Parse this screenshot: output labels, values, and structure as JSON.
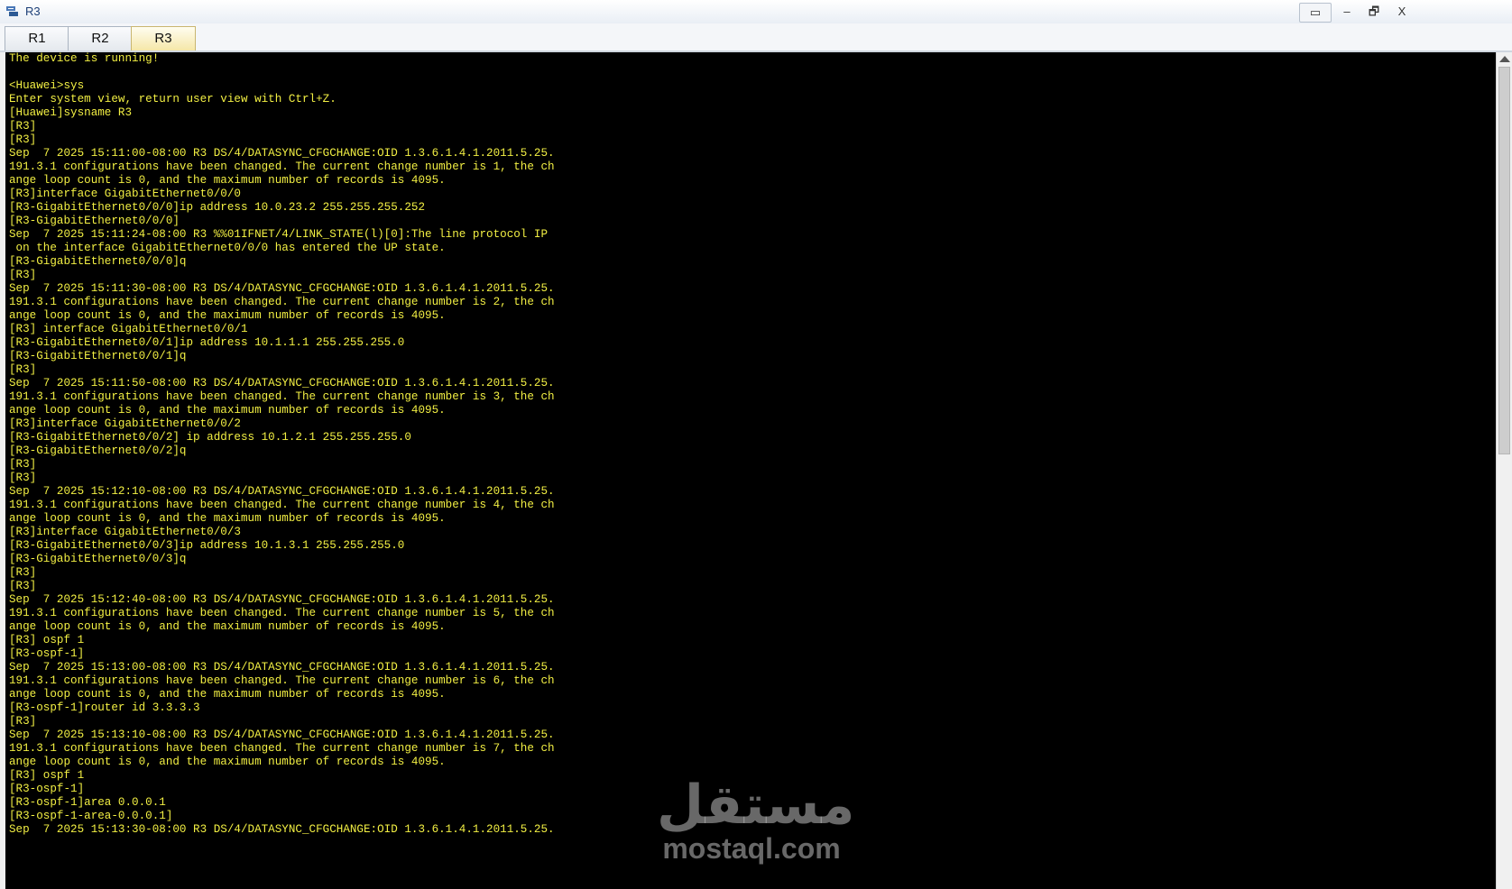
{
  "window": {
    "title": "R3",
    "restore_label": "▭",
    "minimize_label": "–",
    "maximize_label": "🗗",
    "close_label": "X"
  },
  "tabs": [
    {
      "label": "R1",
      "active": false
    },
    {
      "label": "R2",
      "active": false
    },
    {
      "label": "R3",
      "active": true
    }
  ],
  "terminal": {
    "lines": [
      "The device is running!",
      "",
      "<Huawei>sys",
      "Enter system view, return user view with Ctrl+Z.",
      "[Huawei]sysname R3",
      "[R3]",
      "[R3]",
      "Sep  7 2025 15:11:00-08:00 R3 DS/4/DATASYNC_CFGCHANGE:OID 1.3.6.1.4.1.2011.5.25.",
      "191.3.1 configurations have been changed. The current change number is 1, the ch",
      "ange loop count is 0, and the maximum number of records is 4095.",
      "[R3]interface GigabitEthernet0/0/0",
      "[R3-GigabitEthernet0/0/0]ip address 10.0.23.2 255.255.255.252",
      "[R3-GigabitEthernet0/0/0]",
      "Sep  7 2025 15:11:24-08:00 R3 %%01IFNET/4/LINK_STATE(l)[0]:The line protocol IP",
      " on the interface GigabitEthernet0/0/0 has entered the UP state.",
      "[R3-GigabitEthernet0/0/0]q",
      "[R3]",
      "Sep  7 2025 15:11:30-08:00 R3 DS/4/DATASYNC_CFGCHANGE:OID 1.3.6.1.4.1.2011.5.25.",
      "191.3.1 configurations have been changed. The current change number is 2, the ch",
      "ange loop count is 0, and the maximum number of records is 4095.",
      "[R3] interface GigabitEthernet0/0/1",
      "[R3-GigabitEthernet0/0/1]ip address 10.1.1.1 255.255.255.0",
      "[R3-GigabitEthernet0/0/1]q",
      "[R3]",
      "Sep  7 2025 15:11:50-08:00 R3 DS/4/DATASYNC_CFGCHANGE:OID 1.3.6.1.4.1.2011.5.25.",
      "191.3.1 configurations have been changed. The current change number is 3, the ch",
      "ange loop count is 0, and the maximum number of records is 4095.",
      "[R3]interface GigabitEthernet0/0/2",
      "[R3-GigabitEthernet0/0/2] ip address 10.1.2.1 255.255.255.0",
      "[R3-GigabitEthernet0/0/2]q",
      "[R3]",
      "[R3]",
      "Sep  7 2025 15:12:10-08:00 R3 DS/4/DATASYNC_CFGCHANGE:OID 1.3.6.1.4.1.2011.5.25.",
      "191.3.1 configurations have been changed. The current change number is 4, the ch",
      "ange loop count is 0, and the maximum number of records is 4095.",
      "[R3]interface GigabitEthernet0/0/3",
      "[R3-GigabitEthernet0/0/3]ip address 10.1.3.1 255.255.255.0",
      "[R3-GigabitEthernet0/0/3]q",
      "[R3]",
      "[R3]",
      "Sep  7 2025 15:12:40-08:00 R3 DS/4/DATASYNC_CFGCHANGE:OID 1.3.6.1.4.1.2011.5.25.",
      "191.3.1 configurations have been changed. The current change number is 5, the ch",
      "ange loop count is 0, and the maximum number of records is 4095.",
      "[R3] ospf 1",
      "[R3-ospf-1]",
      "Sep  7 2025 15:13:00-08:00 R3 DS/4/DATASYNC_CFGCHANGE:OID 1.3.6.1.4.1.2011.5.25.",
      "191.3.1 configurations have been changed. The current change number is 6, the ch",
      "ange loop count is 0, and the maximum number of records is 4095.",
      "[R3-ospf-1]router id 3.3.3.3",
      "[R3]",
      "Sep  7 2025 15:13:10-08:00 R3 DS/4/DATASYNC_CFGCHANGE:OID 1.3.6.1.4.1.2011.5.25.",
      "191.3.1 configurations have been changed. The current change number is 7, the ch",
      "ange loop count is 0, and the maximum number of records is 4095.",
      "[R3] ospf 1",
      "[R3-ospf-1]",
      "[R3-ospf-1]area 0.0.0.1",
      "[R3-ospf-1-area-0.0.0.1]",
      "Sep  7 2025 15:13:30-08:00 R3 DS/4/DATASYNC_CFGCHANGE:OID 1.3.6.1.4.1.2011.5.25."
    ]
  },
  "watermark": {
    "arabic": "مستقل",
    "latin": "mostaql.com"
  },
  "colors": {
    "terminal_bg": "#000000",
    "terminal_text": "#f2ef43",
    "active_tab": "#f5e7a8"
  }
}
